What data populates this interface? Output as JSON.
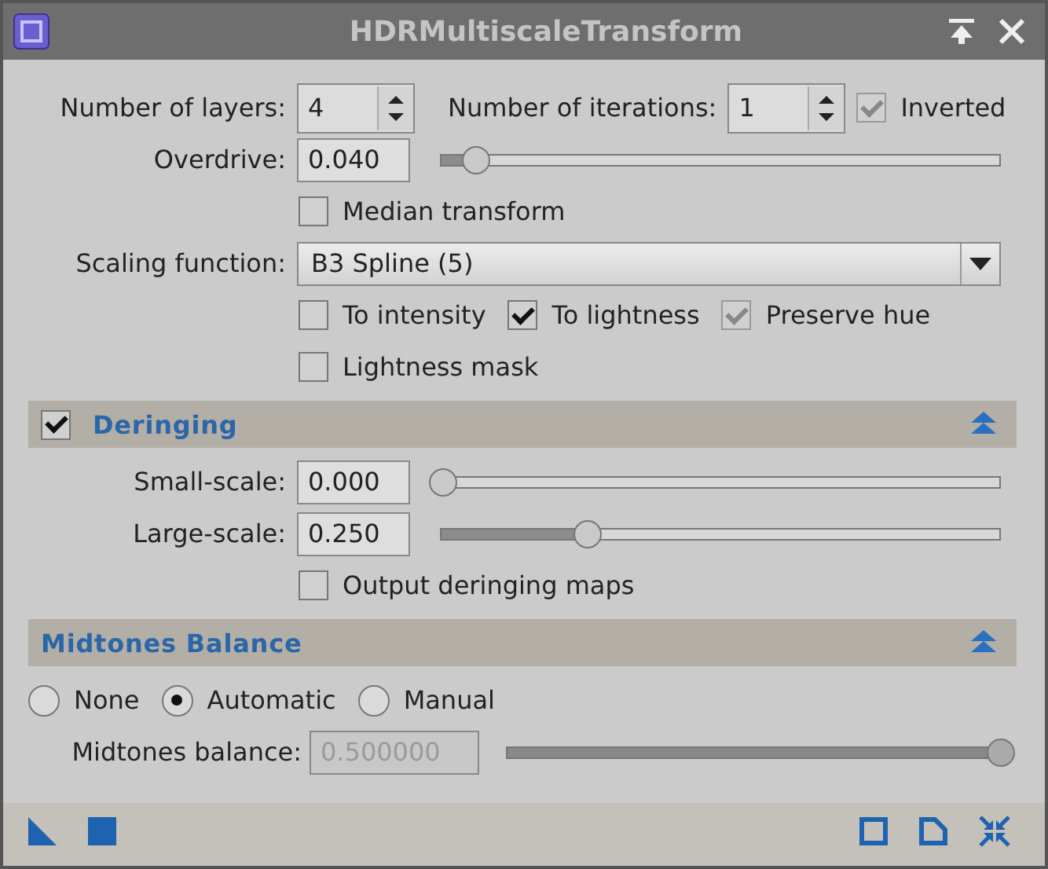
{
  "window": {
    "title": "HDRMultiscaleTransform"
  },
  "layers": {
    "label": "Number of layers:",
    "value": "4"
  },
  "iterations": {
    "label": "Number of iterations:",
    "value": "1"
  },
  "inverted": {
    "label": "Inverted",
    "checked": true,
    "disabled": true
  },
  "overdrive": {
    "label": "Overdrive:",
    "value": "0.040",
    "level": 0.06
  },
  "median_transform": {
    "label": "Median transform",
    "checked": false,
    "disabled": false
  },
  "scaling_function": {
    "label": "Scaling function:",
    "value": "B3 Spline (5)"
  },
  "options": [
    {
      "label": "To intensity",
      "checked": false,
      "disabled": false
    },
    {
      "label": "To lightness",
      "checked": true,
      "disabled": false
    },
    {
      "label": "Preserve hue",
      "checked": true,
      "disabled": true
    }
  ],
  "lightness_mask": {
    "label": "Lightness mask",
    "checked": false,
    "disabled": false
  },
  "deringing": {
    "title": "Deringing",
    "checked": true,
    "expanded": true,
    "sliders": [
      {
        "label": "Small-scale:",
        "value": "0.000",
        "level": 0.0
      },
      {
        "label": "Large-scale:",
        "value": "0.250",
        "level": 0.26
      }
    ],
    "output_maps": {
      "label": "Output deringing maps",
      "checked": false,
      "disabled": false
    }
  },
  "midtones": {
    "title": "Midtones Balance",
    "expanded": true,
    "modes": [
      {
        "label": "None",
        "selected": false
      },
      {
        "label": "Automatic",
        "selected": true
      },
      {
        "label": "Manual",
        "selected": false
      }
    ],
    "balance": {
      "label": "Midtones balance:",
      "value": "0.500000",
      "level": 1.0,
      "disabled": true
    }
  }
}
